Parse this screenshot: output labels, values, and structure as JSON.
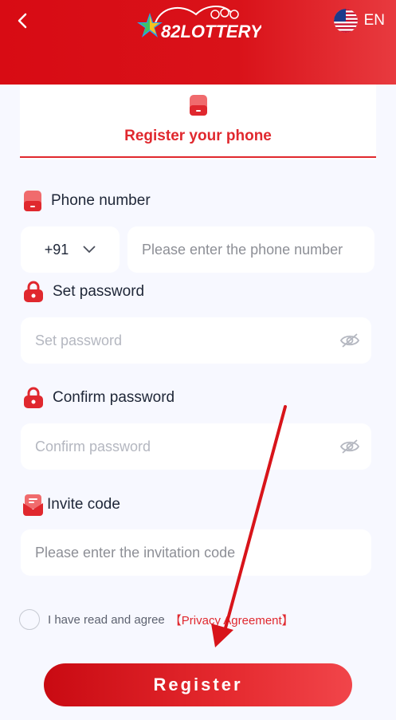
{
  "header": {
    "logo_text": "82LOTTERY",
    "language": "EN"
  },
  "tab": {
    "title": "Register your phone"
  },
  "phone": {
    "label": "Phone number",
    "country_code": "+91",
    "placeholder": "Please enter the phone number"
  },
  "password": {
    "label": "Set password",
    "placeholder": "Set password"
  },
  "confirm": {
    "label": "Confirm password",
    "placeholder": "Confirm password"
  },
  "invite": {
    "label": "Invite code",
    "placeholder": "Please enter the invitation code"
  },
  "agreement": {
    "text": "I have read and agree",
    "link": "【Privacy Agreement】"
  },
  "register_label": "Register",
  "colors": {
    "brand_red": "#d80b14",
    "accent": "#e0282e",
    "background": "#f7f8ff"
  },
  "icons": [
    "back-arrow-icon",
    "us-flag-icon",
    "phone-icon",
    "lock-icon",
    "eye-off-icon",
    "invite-icon",
    "chevron-down-icon"
  ]
}
